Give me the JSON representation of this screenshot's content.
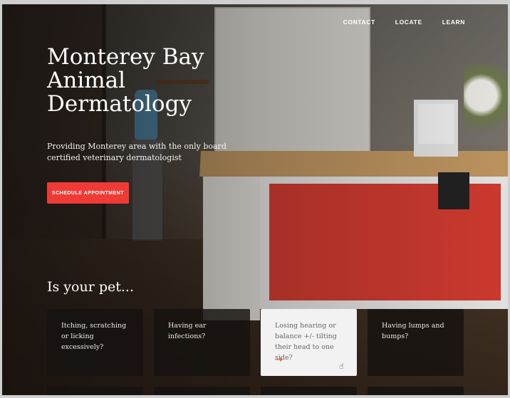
{
  "nav": {
    "items": [
      {
        "label": "CONTACT"
      },
      {
        "label": "LOCATE"
      },
      {
        "label": "LEARN"
      }
    ]
  },
  "hero": {
    "title": "Monterey Bay Animal Dermatology",
    "subtitle": "Providing Monterey area with the only board certified veterinary dermatologist",
    "cta_label": "SCHEDULE APPOINTMENT"
  },
  "symptoms": {
    "heading": "Is your pet...",
    "cards": [
      {
        "text": "Itching, scratching or licking excessively?"
      },
      {
        "text": "Having ear infections?"
      },
      {
        "text": "Losing hearing or balance +/- tilting their head to one side?",
        "arrow": "→"
      },
      {
        "text": "Having lumps and bumps?"
      }
    ]
  },
  "colors": {
    "accent": "#f03a35",
    "card_dark": "#161210",
    "card_active": "#f2f2f2"
  }
}
